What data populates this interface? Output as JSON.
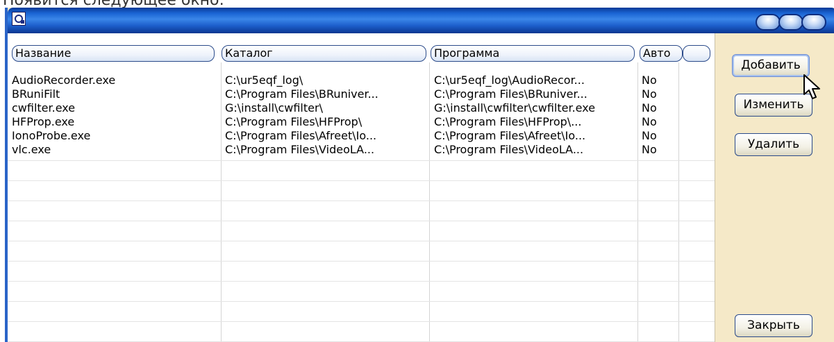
{
  "caption": "Появится следующее окно:",
  "window": {
    "icon": "app-logo-icon",
    "controls": [
      "minimize-icon",
      "maximize-icon",
      "close-icon"
    ]
  },
  "columns": [
    "Название",
    "Каталог",
    "Программа",
    "Авто",
    ""
  ],
  "rows": [
    {
      "name": "AudioRecorder.exe",
      "dir": "C:\\ur5eqf_log\\",
      "program": "C:\\ur5eqf_log\\AudioRecor...",
      "auto": "No"
    },
    {
      "name": "BRuniFilt",
      "dir": "C:\\Program Files\\BRuniver...",
      "program": "C:\\Program Files\\BRuniver...",
      "auto": "No"
    },
    {
      "name": "cwfilter.exe",
      "dir": "G:\\install\\cwfilter\\",
      "program": "G:\\install\\cwfilter\\cwfilter.exe",
      "auto": "No"
    },
    {
      "name": "HFProp.exe",
      "dir": "C:\\Program Files\\HFProp\\",
      "program": "C:\\Program Files\\HFProp\\...",
      "auto": "No"
    },
    {
      "name": "IonoProbe.exe",
      "dir": "C:\\Program Files\\Afreet\\Io...",
      "program": "C:\\Program Files\\Afreet\\Io...",
      "auto": "No"
    },
    {
      "name": "vlc.exe",
      "dir": "C:\\Program Files\\VideoLA...",
      "program": "C:\\Program Files\\VideoLA...",
      "auto": "No"
    }
  ],
  "buttons": {
    "add": "Добавить",
    "edit": "Изменить",
    "delete": "Удалить",
    "close": "Закрыть"
  },
  "cursor": "mouse-pointer-icon"
}
